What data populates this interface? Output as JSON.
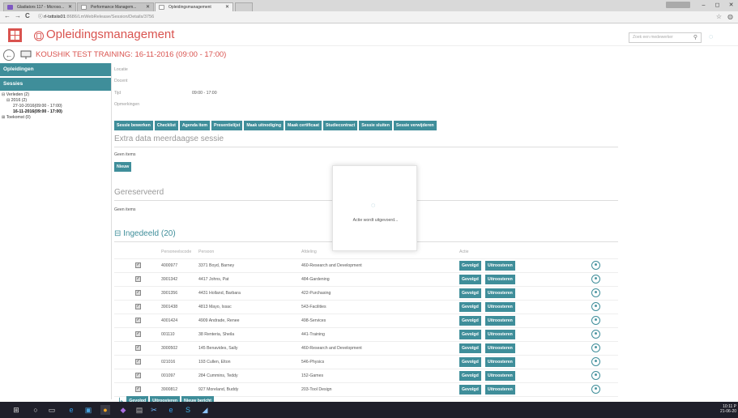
{
  "browser": {
    "tabs": [
      {
        "label": "Gladiators 117 - Microso...",
        "icon_color": "#7e57c2"
      },
      {
        "label": "Performance Managem...",
        "icon_color": "#999999"
      },
      {
        "label": "Opleidingsmanagement",
        "icon_color": "#999999"
      }
    ],
    "url_host": "rl-tsttsiis01",
    "url_path": ":8686/LmWebRelease/Session/Details/3756",
    "nav": {
      "back": "←",
      "forward": "→",
      "reload": "C",
      "info": "ⓘ"
    },
    "window": {
      "minimize": "–",
      "maximize": "◻",
      "close": "✕"
    }
  },
  "app": {
    "title": "Opleidingsmanagement",
    "search_placeholder": "Zoek een medewerker",
    "session_title": "KOUSHIK TEST TRAINING: 16-11-2016 (09:00 - 17:00)",
    "brand_color": "#d9534f",
    "accent_color": "#3f8e9a"
  },
  "sidebar": {
    "heading_opleidingen": "Opleidingen",
    "heading_sessies": "Sessies",
    "tree": {
      "verleden": "⊟ Verleden (2)",
      "year": "⊟ 2016 (2)",
      "s1": "27-10-2016(09:00 - 17:00)",
      "s2": "16-11-2016(09:00 - 17:00)",
      "toekomst": "⊞ Toekomst (0)"
    }
  },
  "details": {
    "locatie": "Locatie",
    "docent": "Docent",
    "tijd": "Tijd",
    "tijd_value": "09:00 - 17:00",
    "opmerkingen": "Opmerkingen"
  },
  "actions": [
    "Sessie bewerken",
    "Checklist",
    "Agenda item",
    "Presentielijst",
    "Maak uitnodiging",
    "Maak certificaat",
    "Studiecontract",
    "Sessie sluiten",
    "Sessie verwijderen"
  ],
  "sections": {
    "extra": "Extra data meerdaagse sessie",
    "geen_items_1": "Geen items",
    "nieuw": "Nieuw",
    "gereserveerd": "Gereserveerd",
    "geen_items_2": "Geen items",
    "ingedeeld": "⊟  Ingedeeld (20)"
  },
  "table": {
    "headers": {
      "code": "Personeelscode",
      "person": "Persoon",
      "afdeling": "Afdeling",
      "actie": "Actie"
    },
    "gevolgd": "Gevolgd",
    "uitroosteren": "Uitroosteren",
    "rows": [
      {
        "code": "4000977",
        "person": "3371 Boyd, Barney",
        "afdeling": "460-Research and Development"
      },
      {
        "code": "3901342",
        "person": "4417 Johns, Pat",
        "afdeling": "484-Gardening"
      },
      {
        "code": "3901356",
        "person": "4431 Holland, Barbara",
        "afdeling": "422-Purchasing"
      },
      {
        "code": "3901438",
        "person": "4813 Mayo, Issac",
        "afdeling": "543-Facilities"
      },
      {
        "code": "4001424",
        "person": "4909 Andrade, Renee",
        "afdeling": "498-Services"
      },
      {
        "code": "001110",
        "person": "38 Renteria, Sheila",
        "afdeling": "441-Training"
      },
      {
        "code": "3000502",
        "person": "145 Benavides, Sally",
        "afdeling": "460-Research and Development"
      },
      {
        "code": "021016",
        "person": "193 Cullen, Elton",
        "afdeling": "546-Physics"
      },
      {
        "code": "001097",
        "person": "284 Cummins, Teddy",
        "afdeling": "152-Games"
      },
      {
        "code": "3900812",
        "person": "927 Moreland, Buddy",
        "afdeling": "203-Tool Design"
      }
    ]
  },
  "bottom_actions": [
    "Gevolgd",
    "Uitroosteren",
    "Nieuw bericht"
  ],
  "modal": {
    "text": "Actie wordt uitgevoerd..."
  },
  "taskbar": {
    "time": "10:11 P",
    "date": "21-06-20"
  }
}
